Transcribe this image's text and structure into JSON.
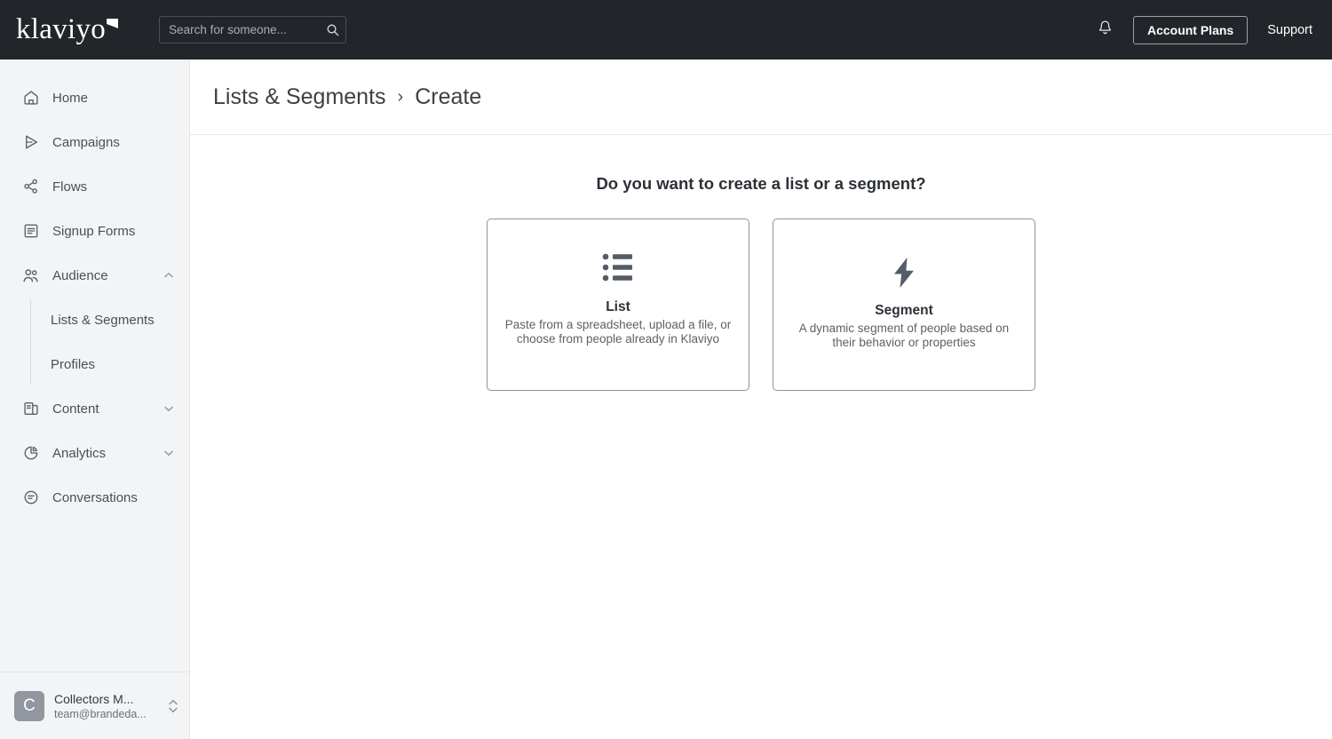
{
  "topbar": {
    "logo_text": "klaviyo",
    "logo_icon": "klaviyo-flag-mark",
    "search": {
      "placeholder": "Search for someone...",
      "value": "",
      "icon": "search-icon"
    },
    "notifications_icon": "bell-icon",
    "account_plans_label": "Account Plans",
    "support_label": "Support"
  },
  "sidebar": {
    "items": [
      {
        "label": "Home",
        "icon": "home-icon",
        "expandable": false
      },
      {
        "label": "Campaigns",
        "icon": "campaigns-send-icon",
        "expandable": false
      },
      {
        "label": "Flows",
        "icon": "flows-nodes-icon",
        "expandable": false
      },
      {
        "label": "Signup Forms",
        "icon": "signup-forms-icon",
        "expandable": false
      },
      {
        "label": "Audience",
        "icon": "audience-people-icon",
        "expandable": true,
        "chevron": "chevron-up-icon"
      },
      {
        "label": "Content",
        "icon": "content-pages-icon",
        "expandable": true,
        "chevron": "chevron-down-icon"
      },
      {
        "label": "Analytics",
        "icon": "analytics-pie-icon",
        "expandable": true,
        "chevron": "chevron-down-icon"
      },
      {
        "label": "Conversations",
        "icon": "conversations-chat-icon",
        "expandable": false
      }
    ],
    "audience_children": [
      {
        "label": "Lists & Segments"
      },
      {
        "label": "Profiles"
      }
    ],
    "account": {
      "avatar_initial": "C",
      "name": "Collectors M...",
      "email": "team@brandeda...",
      "switch_icon": "chevron-up-down-icon"
    }
  },
  "breadcrumb": {
    "parent": "Lists & Segments",
    "separator": "›",
    "current": "Create"
  },
  "main": {
    "question": "Do you want to create a list or a segment?",
    "cards": [
      {
        "id": "list",
        "icon": "bulleted-list-icon",
        "title": "List",
        "description": "Paste from a spreadsheet, upload a file, or choose from people already in Klaviyo"
      },
      {
        "id": "segment",
        "icon": "lightning-bolt-icon",
        "title": "Segment",
        "description": "A dynamic segment of people based on their behavior or properties"
      }
    ]
  },
  "colors": {
    "topbar_bg": "#22262a",
    "sidebar_bg": "#f3f4f5",
    "main_bg": "#ffffff",
    "text_primary": "#2c3136",
    "text_secondary": "#5c6268",
    "card_border": "#8d93a0"
  }
}
